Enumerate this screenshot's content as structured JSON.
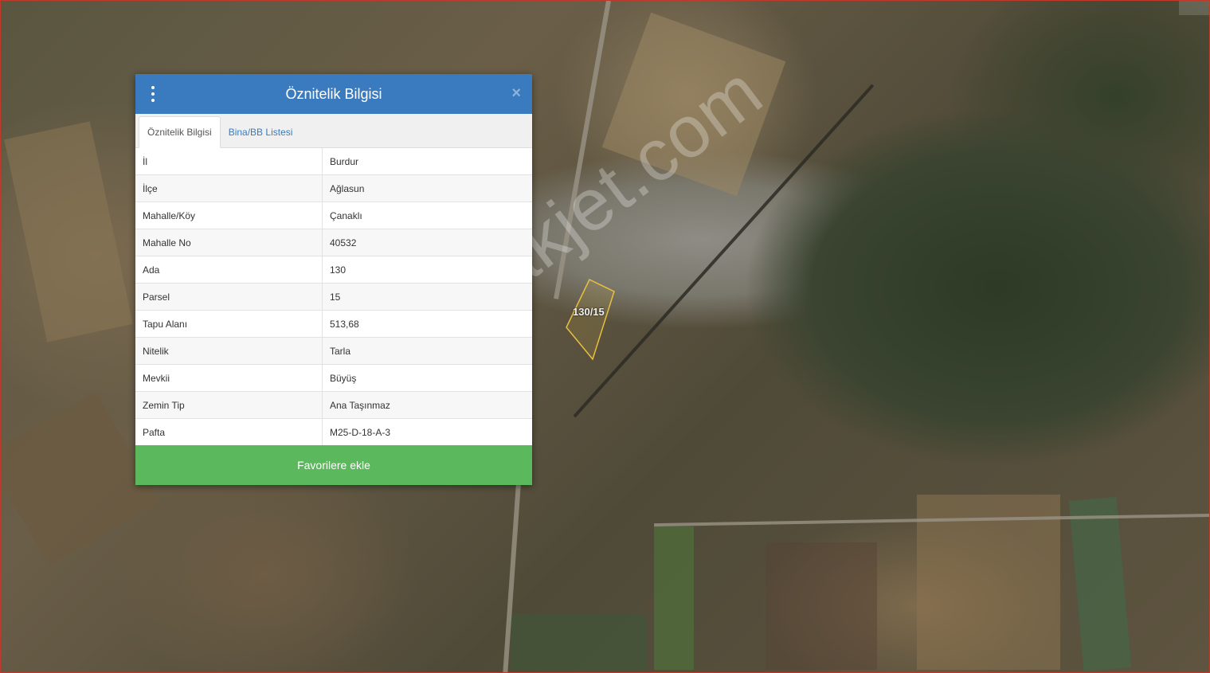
{
  "popup": {
    "title": "Öznitelik Bilgisi",
    "tabs": [
      {
        "label": "Öznitelik Bilgisi",
        "active": true
      },
      {
        "label": "Bina/BB Listesi",
        "active": false
      }
    ],
    "rows": [
      {
        "key": "İl",
        "value": "Burdur"
      },
      {
        "key": "İlçe",
        "value": "Ağlasun"
      },
      {
        "key": "Mahalle/Köy",
        "value": "Çanaklı"
      },
      {
        "key": "Mahalle No",
        "value": "40532"
      },
      {
        "key": "Ada",
        "value": "130"
      },
      {
        "key": "Parsel",
        "value": "15"
      },
      {
        "key": "Tapu Alanı",
        "value": "513,68"
      },
      {
        "key": "Nitelik",
        "value": "Tarla"
      },
      {
        "key": "Mevkii",
        "value": "Büyüş"
      },
      {
        "key": "Zemin Tip",
        "value": "Ana Taşınmaz"
      },
      {
        "key": "Pafta",
        "value": "M25-D-18-A-3"
      }
    ],
    "favorite_button": "Favorilere ekle",
    "menu_icon": "vertical-dots-icon",
    "close_icon": "close-icon"
  },
  "map": {
    "parcel_label": "130/15",
    "watermark": "emlakjet.com"
  },
  "colors": {
    "header": "#3a7bbf",
    "favorite_button": "#5cb85c",
    "tab_link": "#3a7bbf"
  }
}
